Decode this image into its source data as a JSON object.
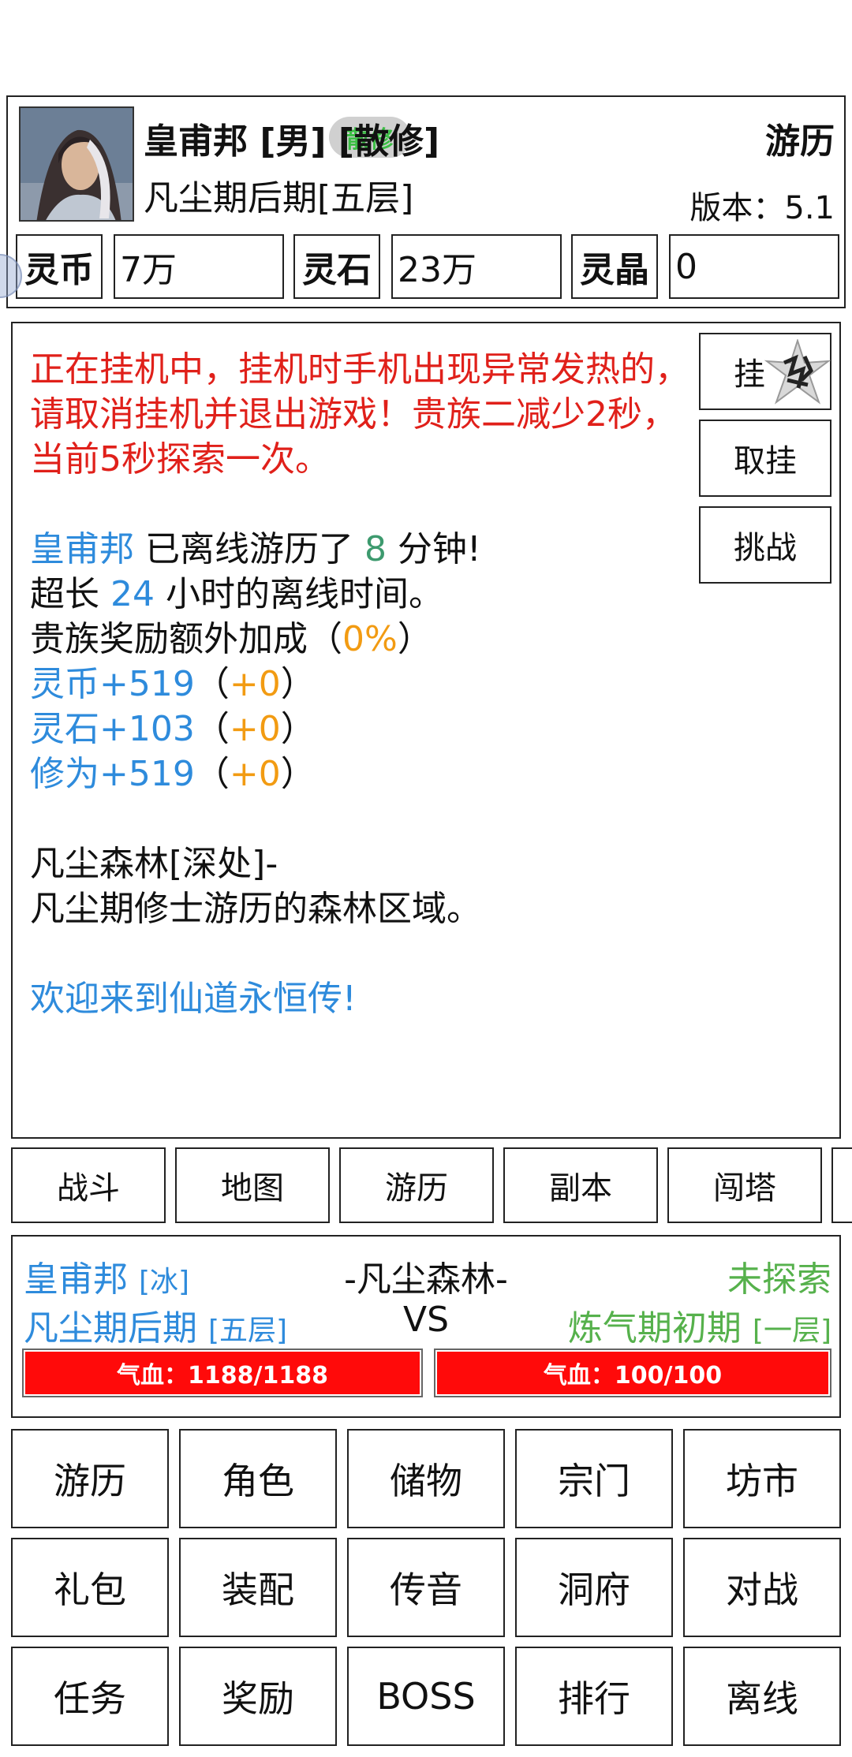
{
  "player": {
    "name": "皇甫邦",
    "gender": "[男]",
    "sect": "[散修]",
    "badge": "散修",
    "realm": "凡尘期后期[五层]",
    "mode": "游历",
    "version": "版本：5.1"
  },
  "currencies": [
    {
      "label": "灵币",
      "value": "7万"
    },
    {
      "label": "灵石",
      "value": "23万"
    },
    {
      "label": "灵晶",
      "value": "0"
    }
  ],
  "log": {
    "warning": "正在挂机中，挂机时手机出现异常发热的，请取消挂机并退出游戏！贵族二减少2秒，当前5秒探索一次。",
    "offline": {
      "name": "皇甫邦",
      "mid": " 已离线游历了 ",
      "minutes": "8",
      "end": " 分钟!"
    },
    "max": {
      "pre": "超长 ",
      "hours": "24",
      "post": " 小时的离线时间。"
    },
    "bonus": {
      "pre": "贵族奖励额外加成（",
      "pct": "0%",
      "post": "）"
    },
    "rewards": [
      {
        "text": "灵币+519",
        "extra": "+0"
      },
      {
        "text": "灵石+103",
        "extra": "+0"
      },
      {
        "text": "修为+519",
        "extra": "+0"
      }
    ],
    "location": "凡尘森林[深处]-",
    "location_desc": "凡尘期修士游历的森林区域。",
    "welcome": "欢迎来到仙道永恒传!"
  },
  "side_buttons": {
    "hang": "挂",
    "cancel": "取挂",
    "challenge": "挑战"
  },
  "tabs": [
    "战斗",
    "地图",
    "游历",
    "副本",
    "闯塔"
  ],
  "battle": {
    "player_name": "皇甫邦",
    "player_element": "[冰]",
    "player_realm": "凡尘期后期",
    "player_layer": "[五层]",
    "map": "-凡尘森林-",
    "vs": "VS",
    "enemy_name": "未探索",
    "enemy_realm": "炼气期初期",
    "enemy_layer": "[一层]",
    "player_hp": "气血：1188/1188",
    "enemy_hp": "气血：100/100"
  },
  "menu": [
    [
      "游历",
      "角色",
      "储物",
      "宗门",
      "坊市"
    ],
    [
      "礼包",
      "装配",
      "传音",
      "洞府",
      "对战"
    ],
    [
      "任务",
      "奖励",
      "BOSS",
      "排行",
      "离线"
    ]
  ],
  "colors": {
    "warning": "#e0201a",
    "blue": "#2e8bdc",
    "green": "#3d9a6e",
    "orange": "#f29b12",
    "hp": "#ff0a0a",
    "enemy": "#56b14c"
  }
}
